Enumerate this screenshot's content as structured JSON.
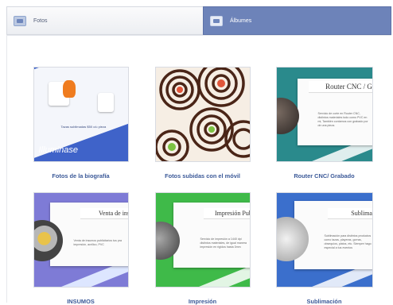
{
  "tabs": [
    {
      "label": "Fotos",
      "icon": "photos-icon",
      "active": false
    },
    {
      "label": "Álbumes",
      "icon": "albums-icon",
      "active": true
    }
  ],
  "colors": {
    "album_title": "#3b5998",
    "active_tab": "#6d83b9"
  },
  "albums": [
    {
      "title": "Fotos de la biografía",
      "cover": {
        "brand": "Illuminase",
        "caption": "Tazas sublimadas $50 c/u pieza"
      }
    },
    {
      "title": "Fotos subidas con el móvil"
    },
    {
      "title": "Router CNC/ Grabado",
      "cover": {
        "heading": "Router CNC / G",
        "text": "Servicio de corte en Router CNC, distintos materiales todo como PVC en mi, También contamos con grabado por de una pieza."
      }
    },
    {
      "title": "INSUMOS",
      "cover": {
        "heading": "Venta de insu",
        "text": "Venta de insumos publicitarios tus pra impresión, acrílico, PVC"
      }
    },
    {
      "title": "Impresión",
      "cover": {
        "heading": "Impresión Publ",
        "text": "Servicio de impresión a 1440 dpi distintos materiales, de igual manera impresión en rígidos hasta 3mm"
      }
    },
    {
      "title": "Sublimación",
      "cover": {
        "heading": "Sublimació",
        "text": "Sublimación para distintos productos como tazas, playeras, gorras, obsequios, platos, etc. Siempre hago especial a tus eventos"
      }
    }
  ]
}
